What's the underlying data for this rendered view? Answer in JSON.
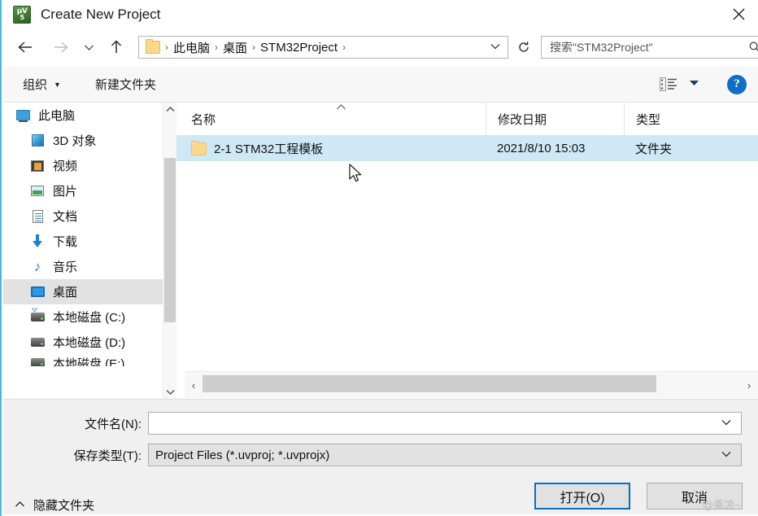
{
  "window": {
    "title": "Create New Project",
    "app_icon": "uvision-logo-icon",
    "close_label": "✕"
  },
  "nav": {
    "back_icon": "arrow-left-icon",
    "forward_icon": "arrow-right-icon",
    "recent_icon": "chevron-down-icon",
    "up_icon": "arrow-up-icon",
    "refresh_icon": "refresh-icon",
    "address_dropdown_icon": "chevron-down-icon",
    "breadcrumbs": [
      {
        "label": "此电脑"
      },
      {
        "label": "桌面"
      },
      {
        "label": "STM32Project"
      }
    ],
    "separator": "›"
  },
  "search": {
    "placeholder": "搜索\"STM32Project\"",
    "icon": "search-icon"
  },
  "toolbar": {
    "organize_label": "组织",
    "organize_caret": "▼",
    "new_folder_label": "新建文件夹",
    "view_icon": "view-mode-icon",
    "view_caret": "▼",
    "help_label": "?"
  },
  "sidebar": {
    "items": [
      {
        "label": "此电脑",
        "icon": "computer-icon",
        "indent": false,
        "selected": false
      },
      {
        "label": "3D 对象",
        "icon": "3d-objects-icon",
        "indent": true,
        "selected": false
      },
      {
        "label": "视频",
        "icon": "videos-icon",
        "indent": true,
        "selected": false
      },
      {
        "label": "图片",
        "icon": "pictures-icon",
        "indent": true,
        "selected": false
      },
      {
        "label": "文档",
        "icon": "documents-icon",
        "indent": true,
        "selected": false
      },
      {
        "label": "下载",
        "icon": "downloads-icon",
        "indent": true,
        "selected": false
      },
      {
        "label": "音乐",
        "icon": "music-icon",
        "indent": true,
        "selected": false
      },
      {
        "label": "桌面",
        "icon": "desktop-icon",
        "indent": true,
        "selected": true
      },
      {
        "label": "本地磁盘 (C:)",
        "icon": "system-drive-icon",
        "indent": true,
        "selected": false
      },
      {
        "label": "本地磁盘 (D:)",
        "icon": "drive-icon",
        "indent": true,
        "selected": false
      }
    ],
    "scroll_up_icon": "chevron-up-icon",
    "scroll_down_icon": "chevron-down-icon"
  },
  "filelist": {
    "columns": [
      {
        "label": "名称",
        "sorted": "asc",
        "sort_caret": "˄"
      },
      {
        "label": "修改日期",
        "sorted": ""
      },
      {
        "label": "类型",
        "sorted": ""
      }
    ],
    "rows": [
      {
        "name": "2-1 STM32工程模板",
        "modified": "2021/8/10 15:03",
        "type": "文件夹",
        "icon": "folder-icon",
        "selected": true
      }
    ],
    "selection_color": "#cfe8f6",
    "hscroll_left_icon": "‹",
    "hscroll_right_icon": "›"
  },
  "form": {
    "filename": {
      "label": "文件名(N):",
      "value": "",
      "dropdown_icon": "chevron-down-icon"
    },
    "filetype": {
      "label": "保存类型(T):",
      "value": "Project Files (*.uvproj; *.uvprojx)",
      "dropdown_icon": "chevron-down-icon"
    }
  },
  "footer": {
    "hide_folders_label": "隐藏文件夹",
    "hide_folders_caret": "˄",
    "open_button": "打开(O)",
    "cancel_button": "取消",
    "watermark": "@乘凉~",
    "accent_color": "#0a6cc4"
  }
}
